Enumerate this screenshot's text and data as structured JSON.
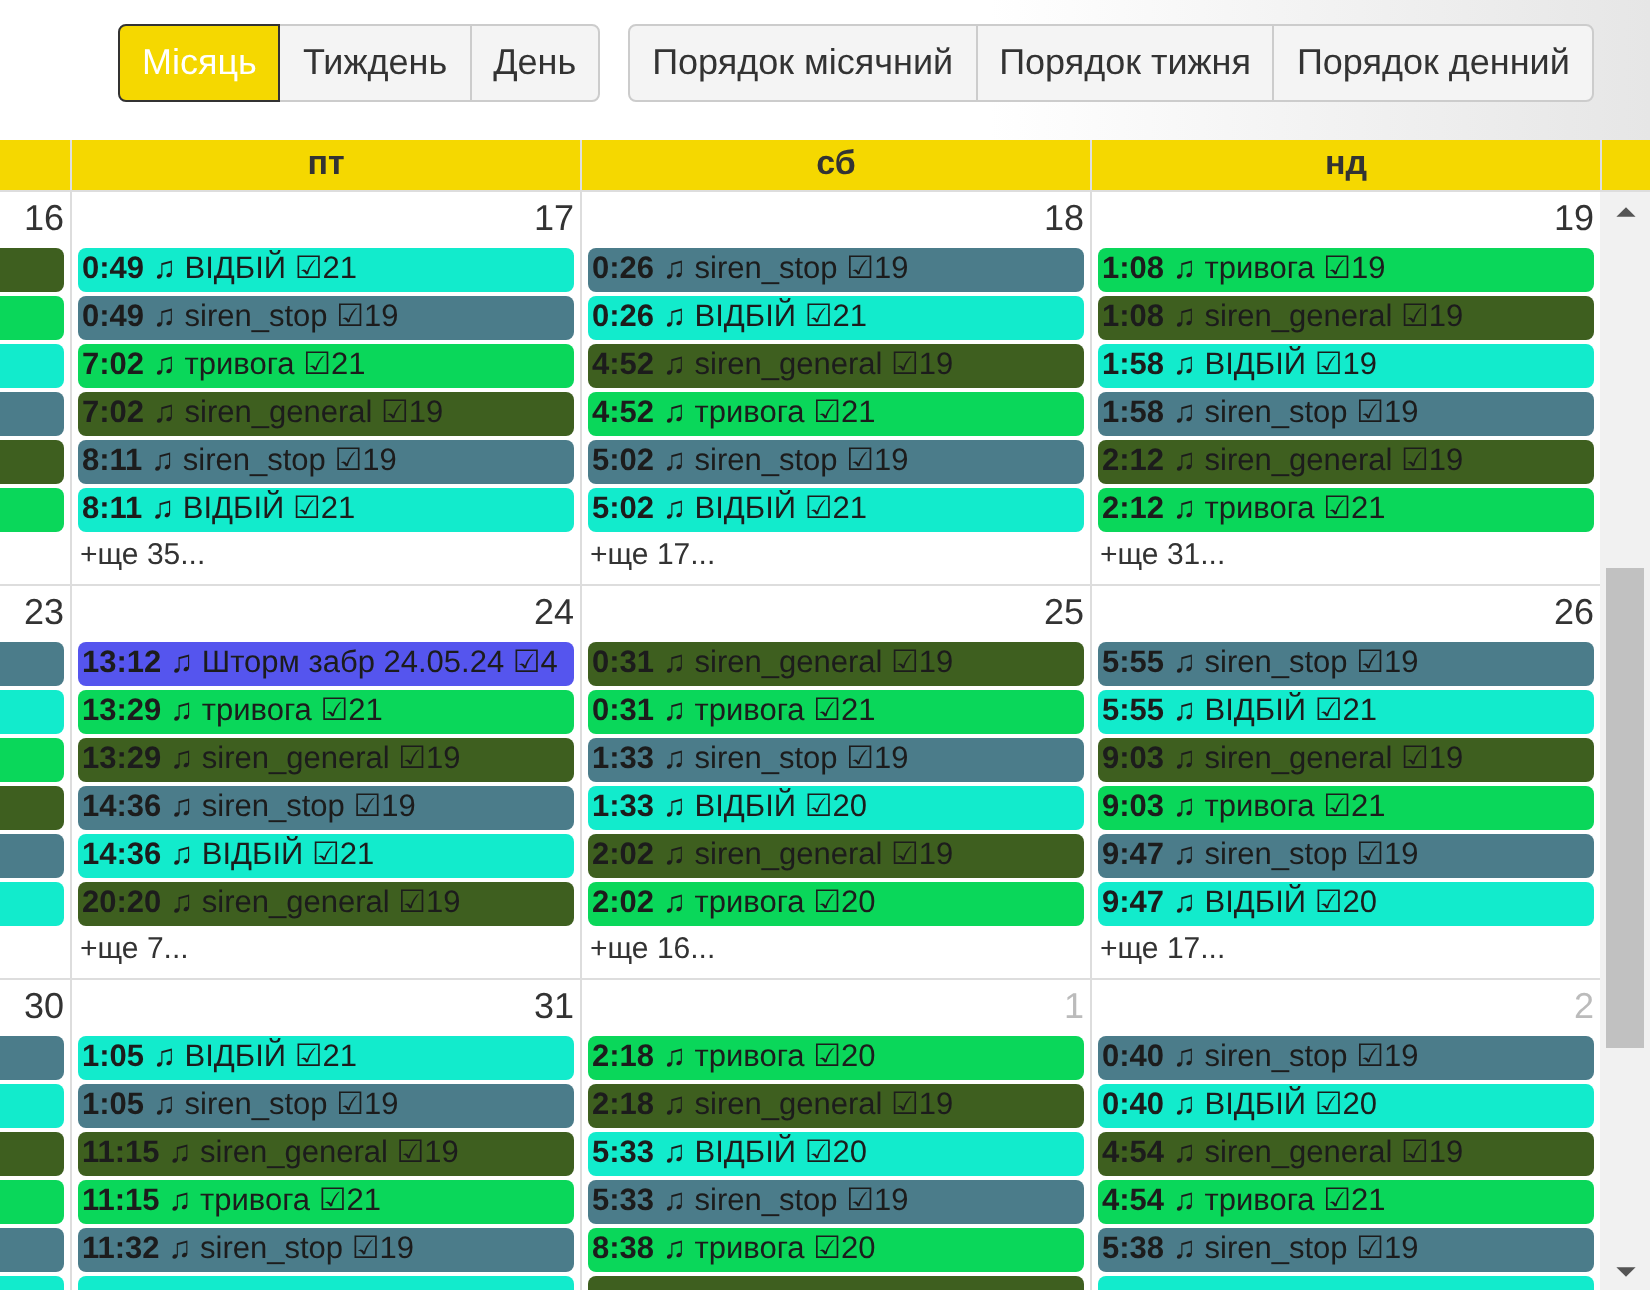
{
  "toolbar": {
    "view_buttons": [
      {
        "label": "Місяць",
        "selected": true
      },
      {
        "label": "Тиждень",
        "selected": false
      },
      {
        "label": "День",
        "selected": false
      }
    ],
    "order_buttons": [
      {
        "label": "Порядок місячний"
      },
      {
        "label": "Порядок тижня"
      },
      {
        "label": "Порядок денний"
      }
    ]
  },
  "calendar": {
    "weekdays": [
      "пт",
      "сб",
      "нд"
    ],
    "weeks": [
      {
        "days": [
          {
            "number": "16",
            "other_month": false,
            "events": [
              {
                "kind": "clipped",
                "color": "#3e5f1f"
              },
              {
                "kind": "clipped",
                "color": "#0ad75a"
              },
              {
                "kind": "clipped",
                "color": "#12ebcc"
              },
              {
                "kind": "clipped",
                "color": "#4b7c8a"
              },
              {
                "kind": "clipped",
                "color": "#3e5f1f"
              },
              {
                "kind": "clipped",
                "color": "#0ad75a"
              }
            ]
          },
          {
            "number": "17",
            "other_month": false,
            "more": "+ще 35...",
            "events": [
              {
                "kind": "event",
                "time": "0:49",
                "text": "♫ ВІДБІЙ ☑21",
                "color": "#12ebcc"
              },
              {
                "kind": "event",
                "time": "0:49",
                "text": "♫ siren_stop ☑19",
                "color": "#4b7c8a"
              },
              {
                "kind": "event",
                "time": "7:02",
                "text": "♫ тривога ☑21",
                "color": "#0ad75a"
              },
              {
                "kind": "event",
                "time": "7:02",
                "text": "♫ siren_general ☑19",
                "color": "#3e5f1f"
              },
              {
                "kind": "event",
                "time": "8:11",
                "text": "♫ siren_stop ☑19",
                "color": "#4b7c8a"
              },
              {
                "kind": "event",
                "time": "8:11",
                "text": "♫ ВІДБІЙ ☑21",
                "color": "#12ebcc"
              }
            ]
          },
          {
            "number": "18",
            "other_month": false,
            "more": "+ще 17...",
            "events": [
              {
                "kind": "event",
                "time": "0:26",
                "text": "♫ siren_stop ☑19",
                "color": "#4b7c8a"
              },
              {
                "kind": "event",
                "time": "0:26",
                "text": "♫ ВІДБІЙ ☑21",
                "color": "#12ebcc"
              },
              {
                "kind": "event",
                "time": "4:52",
                "text": "♫ siren_general ☑19",
                "color": "#3e5f1f"
              },
              {
                "kind": "event",
                "time": "4:52",
                "text": "♫ тривога ☑21",
                "color": "#0ad75a"
              },
              {
                "kind": "event",
                "time": "5:02",
                "text": "♫ siren_stop ☑19",
                "color": "#4b7c8a"
              },
              {
                "kind": "event",
                "time": "5:02",
                "text": "♫ ВІДБІЙ ☑21",
                "color": "#12ebcc"
              }
            ]
          },
          {
            "number": "19",
            "other_month": false,
            "more": "+ще 31...",
            "events": [
              {
                "kind": "event",
                "time": "1:08",
                "text": "♫ тривога ☑19",
                "color": "#0ad75a"
              },
              {
                "kind": "event",
                "time": "1:08",
                "text": "♫ siren_general ☑19",
                "color": "#3e5f1f"
              },
              {
                "kind": "event",
                "time": "1:58",
                "text": "♫ ВІДБІЙ ☑19",
                "color": "#12ebcc"
              },
              {
                "kind": "event",
                "time": "1:58",
                "text": "♫ siren_stop ☑19",
                "color": "#4b7c8a"
              },
              {
                "kind": "event",
                "time": "2:12",
                "text": "♫ siren_general ☑19",
                "color": "#3e5f1f"
              },
              {
                "kind": "event",
                "time": "2:12",
                "text": "♫ тривога ☑21",
                "color": "#0ad75a"
              }
            ]
          }
        ]
      },
      {
        "days": [
          {
            "number": "23",
            "other_month": false,
            "events": [
              {
                "kind": "clipped",
                "color": "#4b7c8a"
              },
              {
                "kind": "clipped",
                "color": "#12ebcc"
              },
              {
                "kind": "clipped",
                "color": "#0ad75a"
              },
              {
                "kind": "clipped",
                "color": "#3e5f1f"
              },
              {
                "kind": "clipped",
                "color": "#4b7c8a"
              },
              {
                "kind": "clipped",
                "color": "#12ebcc"
              }
            ]
          },
          {
            "number": "24",
            "other_month": false,
            "more": "+ще 7...",
            "events": [
              {
                "kind": "event",
                "time": "13:12",
                "text": "♫ Шторм забр 24.05.24 ☑4",
                "color": "#5555ee"
              },
              {
                "kind": "event",
                "time": "13:29",
                "text": "♫ тривога ☑21",
                "color": "#0ad75a"
              },
              {
                "kind": "event",
                "time": "13:29",
                "text": "♫ siren_general ☑19",
                "color": "#3e5f1f"
              },
              {
                "kind": "event",
                "time": "14:36",
                "text": "♫ siren_stop ☑19",
                "color": "#4b7c8a"
              },
              {
                "kind": "event",
                "time": "14:36",
                "text": "♫ ВІДБІЙ ☑21",
                "color": "#12ebcc"
              },
              {
                "kind": "event",
                "time": "20:20",
                "text": "♫ siren_general ☑19",
                "color": "#3e5f1f"
              }
            ]
          },
          {
            "number": "25",
            "other_month": false,
            "more": "+ще 16...",
            "events": [
              {
                "kind": "event",
                "time": "0:31",
                "text": "♫ siren_general ☑19",
                "color": "#3e5f1f"
              },
              {
                "kind": "event",
                "time": "0:31",
                "text": "♫ тривога ☑21",
                "color": "#0ad75a"
              },
              {
                "kind": "event",
                "time": "1:33",
                "text": "♫ siren_stop ☑19",
                "color": "#4b7c8a"
              },
              {
                "kind": "event",
                "time": "1:33",
                "text": "♫ ВІДБІЙ ☑20",
                "color": "#12ebcc"
              },
              {
                "kind": "event",
                "time": "2:02",
                "text": "♫ siren_general ☑19",
                "color": "#3e5f1f"
              },
              {
                "kind": "event",
                "time": "2:02",
                "text": "♫ тривога ☑20",
                "color": "#0ad75a"
              }
            ]
          },
          {
            "number": "26",
            "other_month": false,
            "more": "+ще 17...",
            "events": [
              {
                "kind": "event",
                "time": "5:55",
                "text": "♫ siren_stop ☑19",
                "color": "#4b7c8a"
              },
              {
                "kind": "event",
                "time": "5:55",
                "text": "♫ ВІДБІЙ ☑21",
                "color": "#12ebcc"
              },
              {
                "kind": "event",
                "time": "9:03",
                "text": "♫ siren_general ☑19",
                "color": "#3e5f1f"
              },
              {
                "kind": "event",
                "time": "9:03",
                "text": "♫ тривога ☑21",
                "color": "#0ad75a"
              },
              {
                "kind": "event",
                "time": "9:47",
                "text": "♫ siren_stop ☑19",
                "color": "#4b7c8a"
              },
              {
                "kind": "event",
                "time": "9:47",
                "text": "♫ ВІДБІЙ ☑20",
                "color": "#12ebcc"
              }
            ]
          }
        ]
      },
      {
        "days": [
          {
            "number": "30",
            "other_month": false,
            "events": [
              {
                "kind": "clipped",
                "color": "#4b7c8a"
              },
              {
                "kind": "clipped",
                "color": "#12ebcc"
              },
              {
                "kind": "clipped",
                "color": "#3e5f1f"
              },
              {
                "kind": "clipped",
                "color": "#0ad75a"
              },
              {
                "kind": "clipped",
                "color": "#4b7c8a"
              },
              {
                "kind": "clipped",
                "color": "#12ebcc"
              }
            ]
          },
          {
            "number": "31",
            "other_month": false,
            "events": [
              {
                "kind": "event",
                "time": "1:05",
                "text": "♫ ВІДБІЙ ☑21",
                "color": "#12ebcc"
              },
              {
                "kind": "event",
                "time": "1:05",
                "text": "♫ siren_stop ☑19",
                "color": "#4b7c8a"
              },
              {
                "kind": "event",
                "time": "11:15",
                "text": "♫ siren_general ☑19",
                "color": "#3e5f1f"
              },
              {
                "kind": "event",
                "time": "11:15",
                "text": "♫ тривога ☑21",
                "color": "#0ad75a"
              },
              {
                "kind": "event",
                "time": "11:32",
                "text": "♫ siren_stop ☑19",
                "color": "#4b7c8a"
              },
              {
                "kind": "clipped",
                "color": "#12ebcc"
              }
            ]
          },
          {
            "number": "1",
            "other_month": true,
            "events": [
              {
                "kind": "event",
                "time": "2:18",
                "text": "♫ тривога ☑20",
                "color": "#0ad75a"
              },
              {
                "kind": "event",
                "time": "2:18",
                "text": "♫ siren_general ☑19",
                "color": "#3e5f1f"
              },
              {
                "kind": "event",
                "time": "5:33",
                "text": "♫ ВІДБІЙ ☑20",
                "color": "#12ebcc"
              },
              {
                "kind": "event",
                "time": "5:33",
                "text": "♫ siren_stop ☑19",
                "color": "#4b7c8a"
              },
              {
                "kind": "event",
                "time": "8:38",
                "text": "♫ тривога ☑20",
                "color": "#0ad75a"
              },
              {
                "kind": "clipped",
                "color": "#3e5f1f"
              }
            ]
          },
          {
            "number": "2",
            "other_month": true,
            "events": [
              {
                "kind": "event",
                "time": "0:40",
                "text": "♫ siren_stop ☑19",
                "color": "#4b7c8a"
              },
              {
                "kind": "event",
                "time": "0:40",
                "text": "♫ ВІДБІЙ ☑20",
                "color": "#12ebcc"
              },
              {
                "kind": "event",
                "time": "4:54",
                "text": "♫ siren_general ☑19",
                "color": "#3e5f1f"
              },
              {
                "kind": "event",
                "time": "4:54",
                "text": "♫ тривога ☑21",
                "color": "#0ad75a"
              },
              {
                "kind": "event",
                "time": "5:38",
                "text": "♫ siren_stop ☑19",
                "color": "#4b7c8a"
              },
              {
                "kind": "clipped",
                "color": "#12ebcc"
              }
            ]
          }
        ]
      }
    ]
  }
}
